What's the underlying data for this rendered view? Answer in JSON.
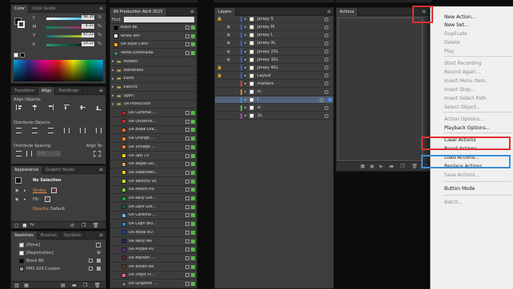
{
  "color_panel": {
    "tabs": [
      "Color",
      "Color Guide"
    ],
    "channels": [
      {
        "label": "C",
        "value": "98.34"
      },
      {
        "label": "M",
        "value": "4.23"
      },
      {
        "label": "Y",
        "value": "67.23"
      },
      {
        "label": "K",
        "value": "14.23"
      }
    ],
    "unit": "%"
  },
  "transform_panel": {
    "tabs": [
      "Transform",
      "Align",
      "Pathfinder"
    ],
    "align_objects": "Align Objects:",
    "distribute_objects": "Distribute Objects:",
    "distribute_spacing": "Distribute Spacing:",
    "align_to": "Align To:",
    "spacing_value": "0 in"
  },
  "appearance_panel": {
    "tabs": [
      "Appearance",
      "Graphic Styles"
    ],
    "selection": "No Selection",
    "stroke_label": "Stroke:",
    "fill_label": "Fill:",
    "opacity_label": "Opacity:",
    "opacity_value": "Default"
  },
  "swatches_panel": {
    "tabs": [
      "Swatches",
      "Brushes",
      "Symbols"
    ],
    "items": [
      "[None]",
      "[Registration]",
      "Black BK",
      "PMS 429 Custom"
    ]
  },
  "graphic_panel": {
    "title": "All Production Abril 2015",
    "find_label": "Find:",
    "items": [
      {
        "name": "Black BK",
        "color": "#000000",
        "type": "folder-item"
      },
      {
        "name": "White WH",
        "color": "#ffffff",
        "type": "folder-item"
      },
      {
        "name": "UA Style Color",
        "color": "#f4a020",
        "type": "folder-item"
      },
      {
        "name": "Verde Esmeralda",
        "color": "#2e8b57",
        "type": "folder-item"
      },
      {
        "name": "Athletic",
        "type": "folder"
      },
      {
        "name": "Battlefield",
        "type": "folder"
      },
      {
        "name": "Earth",
        "type": "folder"
      },
      {
        "name": "Electric",
        "type": "folder"
      },
      {
        "name": "Spirit",
        "type": "folder"
      },
      {
        "name": "UA Production",
        "type": "folder-open"
      },
      {
        "name": "UA Cardinal ...",
        "color": "#b32030"
      },
      {
        "name": "UA Universit...",
        "color": "#c23040"
      },
      {
        "name": "UA Blaze Ora...",
        "color": "#f56a2a"
      },
      {
        "name": "UA Orange ...",
        "color": "#f08228"
      },
      {
        "name": "UA Vintage ...",
        "color": "#e07a40"
      },
      {
        "name": "UA Taxi TX",
        "color": "#f5d020"
      },
      {
        "name": "UA Vegas Go...",
        "color": "#c9a85a"
      },
      {
        "name": "UA Steeltown...",
        "color": "#f0c020"
      },
      {
        "name": "UA Velocity VE",
        "color": "#c8e020"
      },
      {
        "name": "UA Poison PN",
        "color": "#70d040"
      },
      {
        "name": "UA Kelly Gre...",
        "color": "#1fa040"
      },
      {
        "name": "UA Dark Gre...",
        "color": "#1a5a30"
      },
      {
        "name": "UA Carolina ...",
        "color": "#7ab0e0"
      },
      {
        "name": "UA Capri Blu...",
        "color": "#2080d0"
      },
      {
        "name": "UA Royal RO",
        "color": "#2040a0"
      },
      {
        "name": "UA Navy NA",
        "color": "#1a2550"
      },
      {
        "name": "UA Purple PU",
        "color": "#5a2a90"
      },
      {
        "name": "UA Maroon ...",
        "color": "#6a1a2a"
      },
      {
        "name": "UA Brown BR",
        "color": "#5a3a20"
      },
      {
        "name": "UA Tropic Pi...",
        "color": "#f05aa0"
      },
      {
        "name": "UA Graphite ...",
        "color": "#707070"
      }
    ]
  },
  "layers_panel": {
    "title": "Layers",
    "layers": [
      {
        "name": "Jersey S",
        "color": "#3a60d0",
        "eye": false,
        "lock": true
      },
      {
        "name": "Jersey M",
        "color": "#3a60d0",
        "eye": true,
        "lock": false
      },
      {
        "name": "Jersey L",
        "color": "#3a60d0",
        "eye": true,
        "lock": false
      },
      {
        "name": "Jersey XL",
        "color": "#3a60d0",
        "eye": true,
        "lock": false
      },
      {
        "name": "Jersey 2XL",
        "color": "#3a60d0",
        "eye": true,
        "lock": false
      },
      {
        "name": "Jersey 3XL",
        "color": "#3a60d0",
        "eye": true,
        "lock": false
      },
      {
        "name": "Jersey 4XL",
        "color": "#3a60d0",
        "eye": false,
        "lock": true
      },
      {
        "name": "Layout",
        "color": "#3a60d0",
        "eye": false,
        "lock": true
      },
      {
        "name": "markers",
        "color": "#e04040",
        "eye": false,
        "lock": false
      },
      {
        "name": "m",
        "color": "#e08020",
        "eye": false,
        "lock": false
      },
      {
        "name": "l",
        "color": "#3a90e0",
        "eye": false,
        "lock": false,
        "selected": true
      },
      {
        "name": "xl",
        "color": "#40c040",
        "eye": false,
        "lock": false
      },
      {
        "name": "2x",
        "color": "#b040c0",
        "eye": false,
        "lock": false
      }
    ]
  },
  "actions_panel": {
    "title": "Actions"
  },
  "menu": {
    "items": [
      {
        "label": "New Action...",
        "enabled": true
      },
      {
        "label": "New Set...",
        "enabled": true
      },
      {
        "label": "Duplicate",
        "enabled": false
      },
      {
        "label": "Delete",
        "enabled": false
      },
      {
        "label": "Play",
        "enabled": false
      },
      {
        "label": "Start Recording",
        "enabled": false
      },
      {
        "label": "Record Again...",
        "enabled": false
      },
      {
        "label": "Insert Menu Item...",
        "enabled": false
      },
      {
        "label": "Insert Stop...",
        "enabled": false
      },
      {
        "label": "Insert Select Path",
        "enabled": false
      },
      {
        "label": "Select Object...",
        "enabled": false
      },
      {
        "label": "Action Options...",
        "enabled": false
      },
      {
        "label": "Playback Options...",
        "enabled": true
      },
      {
        "label": "Clear Actions",
        "enabled": true
      },
      {
        "label": "Reset Actions",
        "enabled": true
      },
      {
        "label": "Load Actions...",
        "enabled": true
      },
      {
        "label": "Replace Actions...",
        "enabled": true
      },
      {
        "label": "Save Actions...",
        "enabled": false
      },
      {
        "label": "Button Mode",
        "enabled": true
      },
      {
        "label": "Batch...",
        "enabled": false
      }
    ],
    "highlight_colors": {
      "red": "#e03030",
      "blue": "#3a8fd8"
    }
  }
}
